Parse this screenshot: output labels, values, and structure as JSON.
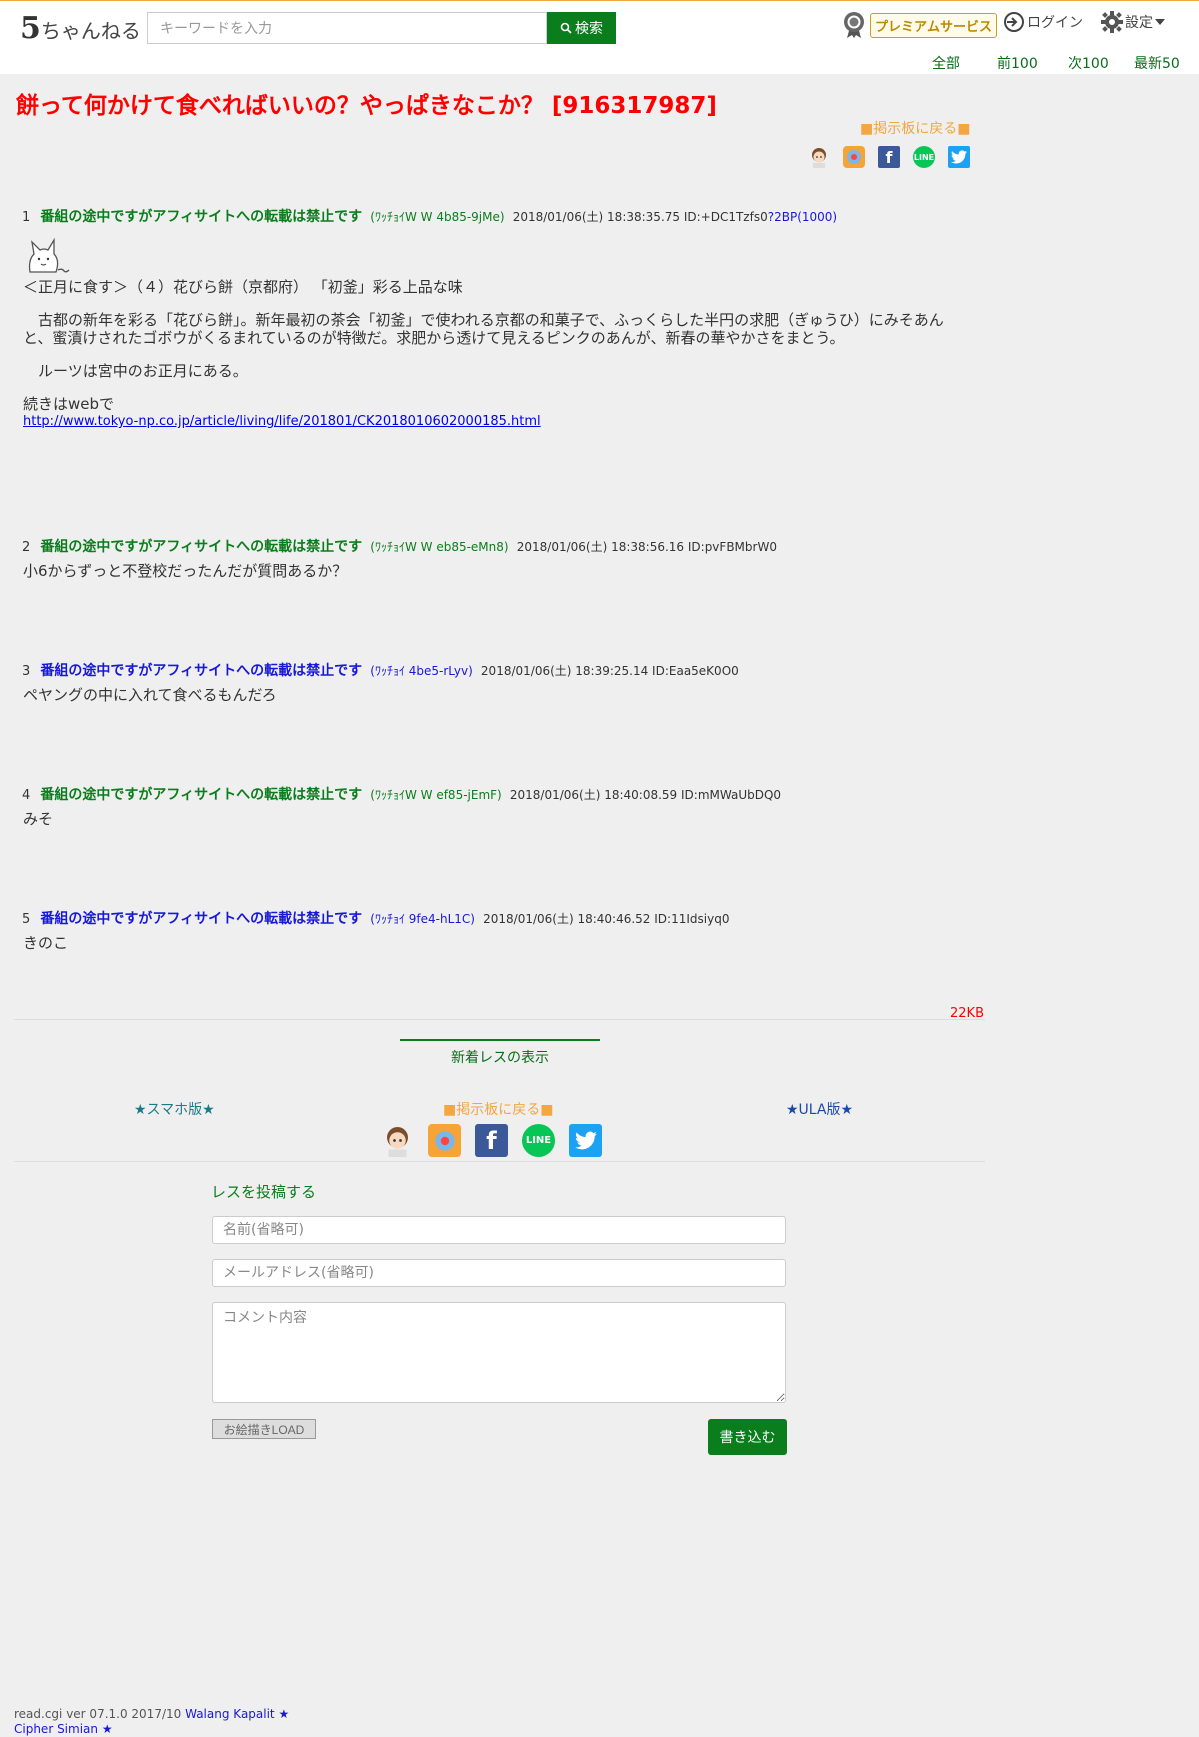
{
  "header": {
    "logo_number": "5",
    "logo_kana": "ちゃんねる",
    "search_placeholder": "キーワードを入力",
    "search_button": "検索",
    "premium": "プレミアムサービス",
    "login": "ログイン",
    "settings": "設定"
  },
  "pagenav": {
    "all": "全部",
    "prev": "前100",
    "next": "次100",
    "latest": "最新50"
  },
  "thread": {
    "title": "餅って何かけて食べればいいの？やっぱきなこか？ [916317987]",
    "back_top": "■掲示板に戻る■"
  },
  "posts": [
    {
      "num": "1",
      "name": "番組の途中ですがアフィサイトへの転載は禁止です",
      "trip": "(ﾜｯﾁｮｲW W 4b85-9jMe)",
      "date": "2018/01/06(土) 18:38:35.75 ID:+DC1Tzfs0",
      "be": "?2BP(1000)",
      "name_color": "green",
      "body": [
        "＜正月に食す＞（４）花びら餅（京都府） 「初釜」彩る上品な味",
        "　古都の新年を彩る「花びら餅」。新年最初の茶会「初釜」で使われる京都の和菓子で、ふっくらした半円の求肥（ぎゅうひ）にみそあんと、蜜漬けされたゴボウがくるまれているのが特徴だ。求肥から透けて見えるピンクのあんが、新春の華やかさをまとう。",
        "　ルーツは宮中のお正月にある。",
        "続きはwebで"
      ],
      "link": "http://www.tokyo-np.co.jp/article/living/life/201801/CK2018010602000185.html"
    },
    {
      "num": "2",
      "name": "番組の途中ですがアフィサイトへの転載は禁止です",
      "trip": "(ﾜｯﾁｮｲW W eb85-eMn8)",
      "date": "2018/01/06(土) 18:38:56.16 ID:pvFBMbrW0",
      "name_color": "green",
      "body": [
        "小6からずっと不登校だったんだが質問あるか？"
      ]
    },
    {
      "num": "3",
      "name": "番組の途中ですがアフィサイトへの転載は禁止です",
      "trip": "(ﾜｯﾁｮｲ 4be5-rLyv)",
      "date": "2018/01/06(土) 18:39:25.14 ID:Eaa5eK0O0",
      "name_color": "blue",
      "body": [
        "ペヤングの中に入れて食べるもんだろ"
      ]
    },
    {
      "num": "4",
      "name": "番組の途中ですがアフィサイトへの転載は禁止です",
      "trip": "(ﾜｯﾁｮｲW W ef85-jEmF)",
      "date": "2018/01/06(土) 18:40:08.59 ID:mMWaUbDQ0",
      "name_color": "green",
      "body": [
        "みそ"
      ]
    },
    {
      "num": "5",
      "name": "番組の途中ですがアフィサイトへの転載は禁止です",
      "trip": "(ﾜｯﾁｮｲ 9fe4-hL1C)",
      "date": "2018/01/06(土) 18:40:46.52 ID:11Idsiyq0",
      "name_color": "blue",
      "body": [
        "きのこ"
      ]
    }
  ],
  "footer": {
    "size": "22KB",
    "new_res": "新着レスの表示",
    "smartphone": "★スマホ版★",
    "back_board": "■掲示板に戻る■",
    "ula": "★ULA版★"
  },
  "form": {
    "title": "レスを投稿する",
    "name_placeholder": "名前(省略可)",
    "email_placeholder": "メールアドレス(省略可)",
    "comment_placeholder": "コメント内容",
    "oekaki": "お絵描きLOAD",
    "submit": "書き込む"
  },
  "credits": {
    "version": "read.cgi ver 07.1.0 2017/10",
    "author1": "Walang Kapalit",
    "author2": "Cipher Simian",
    "star": "★"
  },
  "colors": {
    "accent_green": "#0a7d1c",
    "title_red": "#ff0000",
    "link_orange": "#f4a640",
    "name_blue": "#1818d8"
  }
}
